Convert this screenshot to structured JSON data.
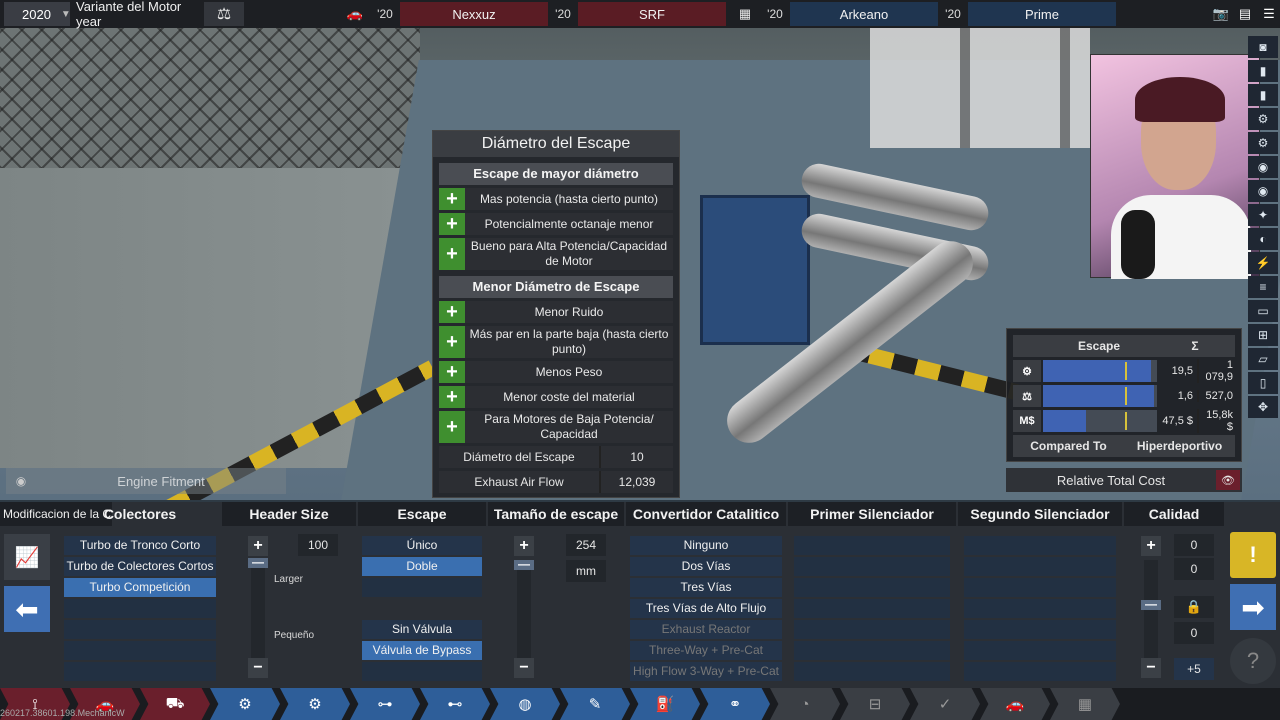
{
  "topbar": {
    "year": "2020",
    "variant": "Variante del Motor year",
    "car1_year": "'20",
    "car1_name": "Nexxuz",
    "car2_year": "'20",
    "car2_name": "SRF",
    "engine1_year": "'20",
    "engine1_name": "Arkeano",
    "engine2_year": "'20",
    "engine2_name": "Prime"
  },
  "info_panel": {
    "title": "Diámetro del Escape",
    "section1_title": "Escape de mayor diámetro",
    "section1_items": [
      "Mas potencia (hasta cierto punto)",
      "Potencialmente octanaje menor",
      "Bueno para Alta Potencia/Capacidad de Motor"
    ],
    "section2_title": "Menor Diámetro de Escape",
    "section2_items": [
      "Menor Ruido",
      "Más par en la parte baja (hasta cierto punto)",
      "Menos Peso",
      "Menor coste del material",
      "Para Motores de Baja Potencia/ Capacidad"
    ],
    "diameter_label": "Diámetro del Escape",
    "diameter_value": "10",
    "airflow_label": "Exhaust Air Flow",
    "airflow_value": "12,039"
  },
  "stats_panel": {
    "header_label": "Escape",
    "header_sum": "Σ",
    "rows": [
      {
        "icon": "⚙",
        "value": "19,5",
        "total": "1 079,9",
        "fill": 0.95,
        "mark": 0.72
      },
      {
        "icon": "⚖",
        "value": "1,6",
        "total": "527,0",
        "fill": 0.97,
        "mark": 0.72
      },
      {
        "icon": "M$",
        "value": "47,5 $",
        "total": "15,8k $",
        "fill": 0.38,
        "mark": 0.72
      }
    ],
    "compared_to_label": "Compared To",
    "compared_to_value": "Hiperdeportivo",
    "relative_cost_label": "Relative Total Cost"
  },
  "engine_fitment": "Engine Fitment",
  "bottom": {
    "mod_label": "Modificacion de la C",
    "colectores": {
      "title": "Colectores",
      "options": [
        "Turbo de Tronco Corto",
        "Turbo de Colectores Cortos",
        "Turbo Competición"
      ],
      "selected": 2
    },
    "header_size": {
      "title": "Header Size",
      "value": "100",
      "larger": "Larger",
      "smaller": "Pequeño"
    },
    "escape": {
      "title": "Escape",
      "options": [
        "Único",
        "Doble"
      ],
      "selected": 1,
      "valve_options": [
        "Sin Válvula",
        "Válvula de Bypass"
      ],
      "valve_selected": 1
    },
    "tamano": {
      "title": "Tamaño de escape",
      "value": "254",
      "unit": "mm"
    },
    "convertidor": {
      "title": "Convertidor Catalitico",
      "options": [
        "Ninguno",
        "Dos Vías",
        "Tres Vías",
        "Tres Vías de Alto Flujo"
      ],
      "disabled_options": [
        "Exhaust Reactor",
        "Three-Way + Pre-Cat",
        "High Flow 3-Way + Pre-Cat"
      ]
    },
    "primer_silenciador": {
      "title": "Primer Silenciador"
    },
    "segundo_silenciador": {
      "title": "Segundo Silenciador"
    },
    "calidad": {
      "title": "Calidad",
      "values": [
        "0",
        "0",
        "0"
      ],
      "plus": "+5"
    }
  },
  "watermark": "260217.38601.198.MechanicW"
}
